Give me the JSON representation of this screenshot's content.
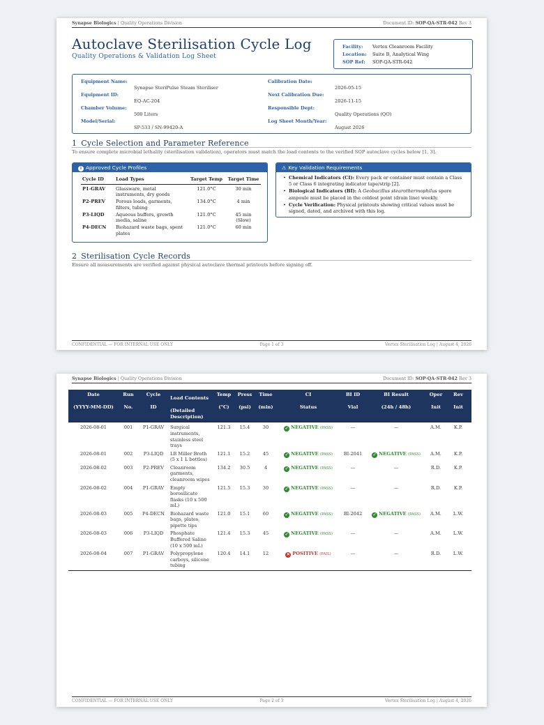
{
  "header": {
    "company": "Synapse Biologics",
    "division": "Quality Operations Division",
    "doc_label": "Document ID:",
    "doc_id": "SOP-QA-STR-042",
    "rev": "Rev 3"
  },
  "title": "Autoclave Sterilisation Cycle Log",
  "subtitle": "Quality Operations & Validation Log Sheet",
  "facility": [
    {
      "key": "Facility:",
      "value": "Vertex Cleanroom Facility"
    },
    {
      "key": "Location:",
      "value": "Suite B, Analytical Wing"
    },
    {
      "key": "SOP Ref:",
      "value": "SOP-QA-STR-042"
    }
  ],
  "equipment": {
    "left": [
      {
        "key": "Equipment Name:",
        "value": "Synapse SteriPulse Steam Steriliser"
      },
      {
        "key": "Equipment ID:",
        "value": "EQ-AC-204"
      },
      {
        "key": "Chamber Volume:",
        "value": "500 Liters"
      },
      {
        "key": "Model/Serial:",
        "value": "SP-533 / SN-99420-A"
      }
    ],
    "right": [
      {
        "key": "Calibration Date:",
        "value": "2026-05-15"
      },
      {
        "key": "Next Calibration Due:",
        "value": "2026-11-15"
      },
      {
        "key": "Responsible Dept:",
        "value": "Quality Operations (QO)"
      },
      {
        "key": "Log Sheet Month/Year:",
        "value": "August 2026"
      }
    ]
  },
  "section1": {
    "num": "1",
    "title": "Cycle Selection and Parameter Reference",
    "intro": "To ensure complete microbial lethality (sterilisation validation), operators must match the load contents to the verified SOP autoclave cycles below [1, 3]."
  },
  "profiles": {
    "heading": "Approved Cycle Profiles",
    "icon": "info-icon",
    "columns": [
      "Cycle ID",
      "Load Types",
      "Target Temp",
      "Target Time"
    ],
    "rows": [
      {
        "id": "P1-GRAV",
        "load": "Glassware, metal instruments, dry goods",
        "temp": "121.0°C",
        "time": "30 min"
      },
      {
        "id": "P2-PREV",
        "load": "Porous loads, garments, filters, tubing",
        "temp": "134.0°C",
        "time": "4 min"
      },
      {
        "id": "P3-LIQD",
        "load": "Aqueous buffers, growth media, saline",
        "temp": "121.0°C",
        "time": "45 min (Slow)"
      },
      {
        "id": "P4-DECN",
        "load": "Biohazard waste bags, spent plates",
        "temp": "121.0°C",
        "time": "60 min"
      }
    ]
  },
  "requirements": {
    "heading": "Key Validation Requirements",
    "icon": "warning-icon",
    "items": [
      {
        "bold": "Chemical Indicators (CI):",
        "pre": "Every pack or container must contain a Class 5 or Class 6 integrating indicator tape/strip [2].",
        "italic": "",
        "post": ""
      },
      {
        "bold": "Biological Indicators (BI):",
        "pre": "A",
        "italic": "Geobacillus stearothermophilus",
        "post": "spore ampoule must be placed in the coldest point (drain line) weekly."
      },
      {
        "bold": "Cycle Verification:",
        "pre": "Physical printouts showing critical values must be signed, dated, and archived with this log.",
        "italic": "",
        "post": ""
      }
    ]
  },
  "section2": {
    "num": "2",
    "title": "Sterilisation Cycle Records",
    "intro": "Ensure all measurements are verified against physical autoclave thermal printouts before signing off."
  },
  "footer": {
    "left": "CONFIDENTIAL — FOR INTERNAL USE ONLY",
    "page1": "Page 1 of 3",
    "page2": "Page 2 of 3",
    "right": "Vertex Sterilisation Log | August 4, 2026"
  },
  "records": {
    "headers": {
      "date": "Date",
      "date_fmt": "(YYYY-MM-DD)",
      "run": "Run",
      "run2": "No.",
      "cycle": "Cycle",
      "cycle2": "ID",
      "load": "Load Contents",
      "load2": "(Detailed Description)",
      "temp": "Temp",
      "temp2": "(°C)",
      "press": "Press",
      "press2": "(psi)",
      "time": "Time",
      "time2": "(min)",
      "ci": "CI",
      "ci2": "Status",
      "biid": "BI ID",
      "biid2": "Vial",
      "bires": "BI Result",
      "bires2": "(24h / 48h)",
      "oper": "Oper",
      "oper2": "Init",
      "rev": "Rev",
      "rev2": "Init"
    },
    "rows": [
      {
        "date": "2026-08-01",
        "run": "001",
        "cycle": "P1-GRAV",
        "load": "Surgical instruments, stainless steel trays",
        "temp": "121.3",
        "press": "15.4",
        "time": "30",
        "ci": "NEGATIVE",
        "ci_tag": "(PASS)",
        "bi_id": "—",
        "bi_result": "—",
        "bi_tag": "",
        "oper": "A.M.",
        "rev": "K.P."
      },
      {
        "date": "2026-08-01",
        "run": "002",
        "cycle": "P3-LIQD",
        "load": "LB Miller Broth (5 x 1 L bottles)",
        "temp": "121.1",
        "press": "15.2",
        "time": "45",
        "ci": "NEGATIVE",
        "ci_tag": "(PASS)",
        "bi_id": "BI-2041",
        "bi_result": "NEGATIVE",
        "bi_tag": "(PASS)",
        "oper": "A.M.",
        "rev": "K.P."
      },
      {
        "date": "2026-08-02",
        "run": "003",
        "cycle": "P2-PREV",
        "load": "Cleanroom garments, cleanroom wipes",
        "temp": "134.2",
        "press": "30.5",
        "time": "4",
        "ci": "NEGATIVE",
        "ci_tag": "(PASS)",
        "bi_id": "—",
        "bi_result": "—",
        "bi_tag": "",
        "oper": "R.D.",
        "rev": "K.P."
      },
      {
        "date": "2026-08-02",
        "run": "004",
        "cycle": "P1-GRAV",
        "load": "Empty borosilicate flasks (10 x 500 mL)",
        "temp": "121.5",
        "press": "15.3",
        "time": "30",
        "ci": "NEGATIVE",
        "ci_tag": "(PASS)",
        "bi_id": "—",
        "bi_result": "—",
        "bi_tag": "",
        "oper": "R.D.",
        "rev": "K.P."
      },
      {
        "date": "2026-08-03",
        "run": "005",
        "cycle": "P4-DECN",
        "load": "Biohazard waste bags, plates, pipette tips",
        "temp": "121.0",
        "press": "15.1",
        "time": "60",
        "ci": "NEGATIVE",
        "ci_tag": "(PASS)",
        "bi_id": "BI-2042",
        "bi_result": "NEGATIVE",
        "bi_tag": "(PASS)",
        "oper": "A.M.",
        "rev": "L.W."
      },
      {
        "date": "2026-08-03",
        "run": "006",
        "cycle": "P3-LIQD",
        "load": "Phosphate Buffered Saline (10 x 500 mL)",
        "temp": "121.4",
        "press": "15.3",
        "time": "45",
        "ci": "NEGATIVE",
        "ci_tag": "(PASS)",
        "bi_id": "—",
        "bi_result": "—",
        "bi_tag": "",
        "oper": "A.M.",
        "rev": "L.W."
      },
      {
        "date": "2026-08-04",
        "run": "007",
        "cycle": "P1-GRAV",
        "load": "Polypropylene carboys, silicone tubing",
        "temp": "120.4",
        "press": "14.1",
        "time": "12",
        "ci": "POSITIVE",
        "ci_tag": "(FAIL)",
        "bi_id": "—",
        "bi_result": "—",
        "bi_tag": "",
        "oper": "R.D.",
        "rev": "L.W."
      }
    ]
  },
  "colors": {
    "navy": "#1e3560",
    "blue": "#2e62a8",
    "pass": "#2e8b2e",
    "fail": "#c0392b"
  }
}
